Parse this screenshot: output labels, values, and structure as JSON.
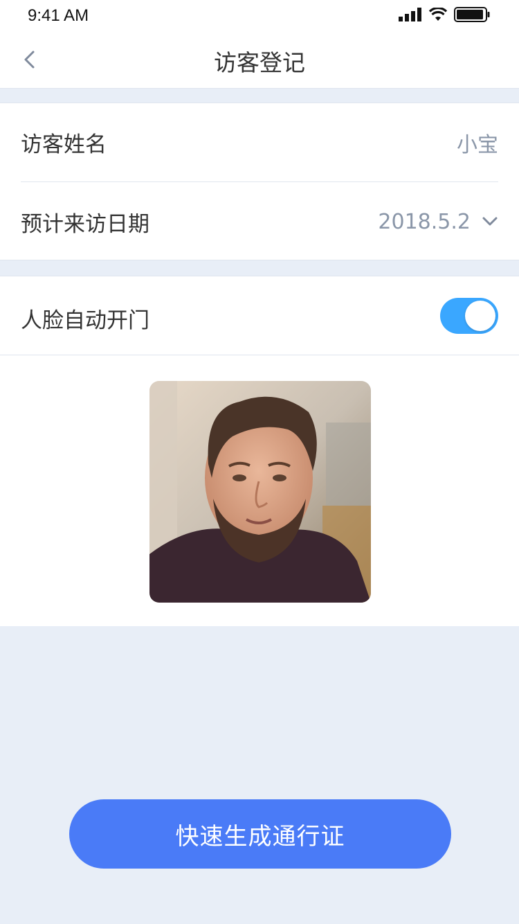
{
  "statusbar": {
    "time": "9:41 AM",
    "icons": [
      "signal-icon",
      "wifi-icon",
      "battery-icon"
    ]
  },
  "navbar": {
    "back_icon": "chevron-left-icon",
    "title": "访客登记"
  },
  "form": {
    "visitor_name_label": "访客姓名",
    "visitor_name_value": "小宝",
    "visit_date_label": "预计来访日期",
    "visit_date_value": "2018.5.2",
    "visit_date_icon": "chevron-down-icon"
  },
  "face_unlock": {
    "label": "人脸自动开门",
    "enabled": true
  },
  "photo": {
    "icon": "face-photo"
  },
  "actions": {
    "generate_pass_label": "快速生成通行证"
  },
  "colors": {
    "accent": "#4a7bf7",
    "toggle": "#3aa7ff",
    "background": "#e8eef7"
  }
}
